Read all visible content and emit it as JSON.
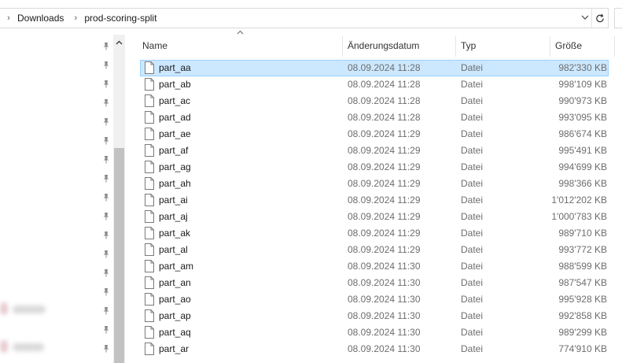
{
  "breadcrumb": [
    "Downloads",
    "prod-scoring-split"
  ],
  "columns": {
    "name": "Name",
    "date": "Änderungsdatum",
    "type": "Typ",
    "size": "Größe"
  },
  "files": [
    {
      "name": "part_aa",
      "date": "08.09.2024 11:28",
      "type": "Datei",
      "size": "982'330 KB",
      "selected": true
    },
    {
      "name": "part_ab",
      "date": "08.09.2024 11:28",
      "type": "Datei",
      "size": "998'109 KB"
    },
    {
      "name": "part_ac",
      "date": "08.09.2024 11:28",
      "type": "Datei",
      "size": "990'973 KB"
    },
    {
      "name": "part_ad",
      "date": "08.09.2024 11:28",
      "type": "Datei",
      "size": "993'095 KB"
    },
    {
      "name": "part_ae",
      "date": "08.09.2024 11:29",
      "type": "Datei",
      "size": "986'674 KB"
    },
    {
      "name": "part_af",
      "date": "08.09.2024 11:29",
      "type": "Datei",
      "size": "995'491 KB"
    },
    {
      "name": "part_ag",
      "date": "08.09.2024 11:29",
      "type": "Datei",
      "size": "994'699 KB"
    },
    {
      "name": "part_ah",
      "date": "08.09.2024 11:29",
      "type": "Datei",
      "size": "998'366 KB"
    },
    {
      "name": "part_ai",
      "date": "08.09.2024 11:29",
      "type": "Datei",
      "size": "1'012'202 KB"
    },
    {
      "name": "part_aj",
      "date": "08.09.2024 11:29",
      "type": "Datei",
      "size": "1'000'783 KB"
    },
    {
      "name": "part_ak",
      "date": "08.09.2024 11:29",
      "type": "Datei",
      "size": "989'710 KB"
    },
    {
      "name": "part_al",
      "date": "08.09.2024 11:29",
      "type": "Datei",
      "size": "993'772 KB"
    },
    {
      "name": "part_am",
      "date": "08.09.2024 11:30",
      "type": "Datei",
      "size": "988'599 KB"
    },
    {
      "name": "part_an",
      "date": "08.09.2024 11:30",
      "type": "Datei",
      "size": "987'547 KB"
    },
    {
      "name": "part_ao",
      "date": "08.09.2024 11:30",
      "type": "Datei",
      "size": "995'928 KB"
    },
    {
      "name": "part_ap",
      "date": "08.09.2024 11:30",
      "type": "Datei",
      "size": "992'858 KB"
    },
    {
      "name": "part_aq",
      "date": "08.09.2024 11:30",
      "type": "Datei",
      "size": "989'299 KB"
    },
    {
      "name": "part_ar",
      "date": "08.09.2024 11:30",
      "type": "Datei",
      "size": "774'910 KB"
    }
  ],
  "colors": {
    "selection_fill": "#cce8ff",
    "selection_border": "#99d1ff",
    "secondary_text": "#6d6d6d"
  },
  "icons": {
    "pin": "pin-icon",
    "file": "file-icon",
    "refresh": "refresh-icon",
    "dropdown": "chevron-down-icon"
  }
}
